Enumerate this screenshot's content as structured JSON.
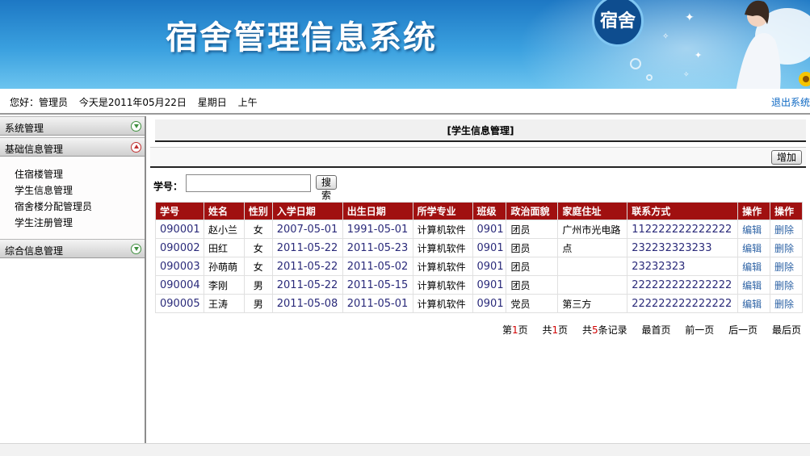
{
  "banner": {
    "title": "宿舍管理信息系统",
    "badge": "宿舍"
  },
  "infobar": {
    "greeting": "您好：管理员",
    "date": "今天是2011年05月22日",
    "weekday": "星期日",
    "period": "上午",
    "logout": "退出系统"
  },
  "sidebar": {
    "menus": [
      {
        "label": "系统管理",
        "expanded": false
      },
      {
        "label": "基础信息管理",
        "expanded": true
      },
      {
        "label": "综合信息管理",
        "expanded": false
      }
    ],
    "items": [
      "住宿楼管理",
      "学生信息管理",
      "宿舍楼分配管理员",
      "学生注册管理"
    ]
  },
  "main": {
    "section_title": "[学生信息管理]",
    "add_button": "增加",
    "search_label": "学号：",
    "search_value": "",
    "search_button": "搜索"
  },
  "table": {
    "headers": [
      "学号",
      "姓名",
      "性别",
      "入学日期",
      "出生日期",
      "所学专业",
      "班级",
      "政治面貌",
      "家庭住址",
      "联系方式",
      "操作",
      "操作"
    ],
    "rows": [
      [
        "090001",
        "赵小兰",
        "女",
        "2007-05-01",
        "1991-05-01",
        "计算机软件",
        "0901",
        "团员",
        "广州市光电路",
        "112222222222222",
        "编辑",
        "删除"
      ],
      [
        "090002",
        "田红",
        "女",
        "2011-05-22",
        "2011-05-23",
        "计算机软件",
        "0901",
        "团员",
        "点",
        "232232323233",
        "编辑",
        "删除"
      ],
      [
        "090003",
        "孙萌萌",
        "女",
        "2011-05-22",
        "2011-05-02",
        "计算机软件",
        "0901",
        "团员",
        "",
        "23232323",
        "编辑",
        "删除"
      ],
      [
        "090004",
        "李刚",
        "男",
        "2011-05-22",
        "2011-05-15",
        "计算机软件",
        "0901",
        "团员",
        "",
        "222222222222222",
        "编辑",
        "删除"
      ],
      [
        "090005",
        "王涛",
        "男",
        "2011-05-08",
        "2011-05-01",
        "计算机软件",
        "0901",
        "党员",
        "第三方",
        "222222222222222",
        "编辑",
        "删除"
      ]
    ]
  },
  "pager": {
    "current_prefix": "第",
    "current": "1",
    "current_suffix": "页",
    "total_prefix": "共",
    "total_pages": "1",
    "total_suffix": "页",
    "records_prefix": "共",
    "records": "5",
    "records_suffix": "条记录",
    "first": "最首页",
    "prev": "前一页",
    "next": "后一页",
    "last": "最后页"
  },
  "colors": {
    "header_red": "#a01010",
    "banner_blue": "#1d78c4",
    "link_blue": "#0a66c2"
  }
}
